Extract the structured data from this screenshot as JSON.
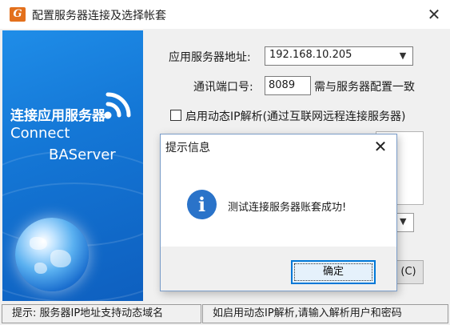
{
  "window": {
    "title": "配置服务器连接及选择帐套",
    "icon": "app-logo-icon",
    "icon_glyph": "G",
    "close_glyph": "✕"
  },
  "banner": {
    "line1": "连接应用服务器",
    "line2": "Connect",
    "line3": "BAServer",
    "icons": [
      "wifi-icon",
      "globe-icon"
    ]
  },
  "form": {
    "server_address_label": "应用服务器地址:",
    "server_address_value": "192.168.10.205",
    "port_label": "通讯端口号:",
    "port_value": "8089",
    "port_hint": "需与服务器配置一致",
    "dynamic_ip_label": "启用动态IP解析(通过互联网远程连接服务器)",
    "dynamic_ip_checked": false,
    "c_button_label": "(C)"
  },
  "statusbar": {
    "left": "提示: 服务器IP地址支持动态域名",
    "right": "如启用动态IP解析,请输入解析用户和密码"
  },
  "dialog": {
    "title": "提示信息",
    "icon": "info-icon",
    "icon_glyph": "i",
    "message": "测试连接服务器账套成功!",
    "ok_label": "确定",
    "close_glyph": "✕"
  },
  "colors": {
    "banner_blue": "#1477d6",
    "info_blue": "#2a73c9",
    "focus_blue": "#0078d7",
    "app_icon_orange": "#e3701c"
  }
}
